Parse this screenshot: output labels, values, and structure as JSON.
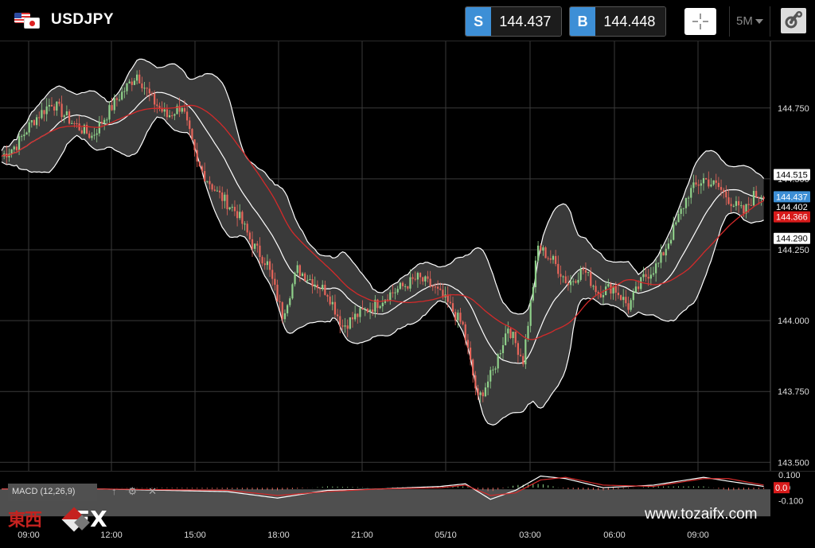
{
  "header": {
    "symbol": "USDJPY",
    "sell": {
      "tag": "S",
      "price": "144.437"
    },
    "buy": {
      "tag": "B",
      "price": "144.448"
    },
    "timeframe": "5M"
  },
  "colors": {
    "up_candle": "#8fd18a",
    "down_candle": "#e8655a",
    "sma": "#d42a2a",
    "bands": "#ffffff",
    "band_fill": "#3a3a3a",
    "sell_tag": "#3d8fd6",
    "label_red": "#d81b1b"
  },
  "chart_data": {
    "type": "candlestick",
    "x_ticks": [
      "09:00",
      "12:00",
      "15:00",
      "18:00",
      "21:00",
      "05/10",
      "03:00",
      "06:00",
      "09:00"
    ],
    "y_ticks": [
      "144.750",
      "144.500",
      "144.250",
      "144.000",
      "143.750",
      "143.500"
    ],
    "ylim": [
      143.47,
      144.985
    ],
    "price_labels": [
      {
        "text": "144.515",
        "value": 144.515,
        "style": "white"
      },
      {
        "text": "144.437",
        "value": 144.437,
        "style": "blue"
      },
      {
        "text": "144.402",
        "value": 144.402,
        "style": "plain"
      },
      {
        "text": "144.366",
        "value": 144.366,
        "style": "red"
      },
      {
        "text": "144.290",
        "value": 144.29,
        "style": "white"
      }
    ],
    "close_anchors": [
      [
        0,
        144.58
      ],
      [
        6,
        144.62
      ],
      [
        12,
        144.7
      ],
      [
        20,
        144.77
      ],
      [
        28,
        144.7
      ],
      [
        36,
        144.65
      ],
      [
        46,
        144.78
      ],
      [
        54,
        144.87
      ],
      [
        60,
        144.78
      ],
      [
        66,
        144.72
      ],
      [
        72,
        144.76
      ],
      [
        78,
        144.55
      ],
      [
        86,
        144.45
      ],
      [
        94,
        144.38
      ],
      [
        100,
        144.27
      ],
      [
        106,
        144.2
      ],
      [
        112,
        144.02
      ],
      [
        118,
        144.18
      ],
      [
        124,
        144.14
      ],
      [
        130,
        144.1
      ],
      [
        136,
        143.98
      ],
      [
        142,
        144.02
      ],
      [
        148,
        144.05
      ],
      [
        154,
        144.09
      ],
      [
        160,
        144.12
      ],
      [
        166,
        144.15
      ],
      [
        172,
        144.12
      ],
      [
        178,
        144.06
      ],
      [
        184,
        143.98
      ],
      [
        190,
        143.72
      ],
      [
        196,
        143.82
      ],
      [
        202,
        143.98
      ],
      [
        208,
        143.86
      ],
      [
        214,
        144.26
      ],
      [
        220,
        144.21
      ],
      [
        226,
        144.13
      ],
      [
        232,
        144.18
      ],
      [
        238,
        144.1
      ],
      [
        244,
        144.12
      ],
      [
        250,
        144.05
      ],
      [
        256,
        144.15
      ],
      [
        262,
        144.2
      ],
      [
        268,
        144.32
      ],
      [
        274,
        144.45
      ],
      [
        280,
        144.5
      ],
      [
        286,
        144.47
      ],
      [
        292,
        144.41
      ],
      [
        296,
        144.38
      ],
      [
        300,
        144.44
      ],
      [
        304,
        144.45
      ]
    ],
    "macd": {
      "y_ticks": [
        "0.100",
        "0.0",
        "-0.100"
      ],
      "ylim": [
        -0.14,
        0.13
      ],
      "current": "0.0",
      "anchors": [
        [
          0,
          -0.01
        ],
        [
          40,
          -0.01
        ],
        [
          90,
          -0.03
        ],
        [
          110,
          -0.08
        ],
        [
          130,
          -0.02
        ],
        [
          150,
          -0.01
        ],
        [
          175,
          0.01
        ],
        [
          185,
          0.03
        ],
        [
          195,
          -0.09
        ],
        [
          205,
          -0.02
        ],
        [
          215,
          0.09
        ],
        [
          225,
          0.07
        ],
        [
          240,
          0.0
        ],
        [
          260,
          0.02
        ],
        [
          280,
          0.08
        ],
        [
          290,
          0.05
        ],
        [
          304,
          0.01
        ]
      ],
      "signal_anchors": [
        [
          0,
          -0.01
        ],
        [
          40,
          -0.01
        ],
        [
          90,
          -0.02
        ],
        [
          110,
          -0.06
        ],
        [
          130,
          -0.03
        ],
        [
          150,
          -0.01
        ],
        [
          175,
          0.0
        ],
        [
          185,
          0.02
        ],
        [
          195,
          -0.06
        ],
        [
          205,
          -0.04
        ],
        [
          215,
          0.06
        ],
        [
          225,
          0.08
        ],
        [
          240,
          0.02
        ],
        [
          260,
          0.01
        ],
        [
          280,
          0.07
        ],
        [
          290,
          0.07
        ],
        [
          304,
          0.02
        ]
      ]
    }
  },
  "macd_panel": {
    "label": "MACD (12,26,9)"
  },
  "watermark": {
    "kanji": "東西",
    "fx": "FX",
    "site": "www.tozaifx.com"
  }
}
